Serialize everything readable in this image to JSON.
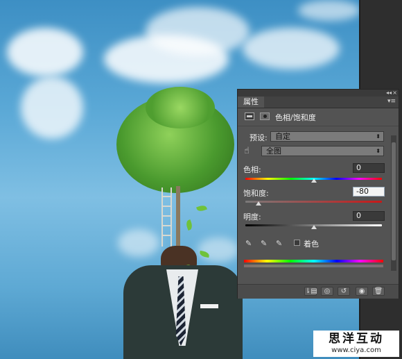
{
  "panel": {
    "collapse_glyph": "◂◂",
    "close_glyph": "×",
    "menu_glyph": "▾≡",
    "tab_label": "属性",
    "adjustment_title": "色相/饱和度",
    "preset_label": "预设:",
    "preset_value": "自定",
    "channel_value": "全图",
    "hue_label": "色相:",
    "hue_value": "0",
    "saturation_label": "饱和度:",
    "saturation_value": "-80",
    "lightness_label": "明度:",
    "lightness_value": "0",
    "colorize_label": "着色",
    "slider_levels": {
      "hue": 0,
      "saturation": -80,
      "lightness": 0
    }
  },
  "watermark": {
    "title": "思洋互动",
    "url": "www.ciya.com"
  },
  "icons": [
    "adjustment-layer-icon",
    "mask-icon",
    "hand-target-icon",
    "eyedropper-icon",
    "eyedropper-plus-icon",
    "eyedropper-minus-icon",
    "clip-layer-icon",
    "view-previous-icon",
    "reset-icon",
    "visibility-icon",
    "trash-icon"
  ],
  "colors": {
    "sky_top": "#3d8fc4",
    "sky_mid": "#7fbfe3",
    "panel_bg": "#535353",
    "foliage": "#4a9a2e",
    "suit": "#2c3a38"
  }
}
